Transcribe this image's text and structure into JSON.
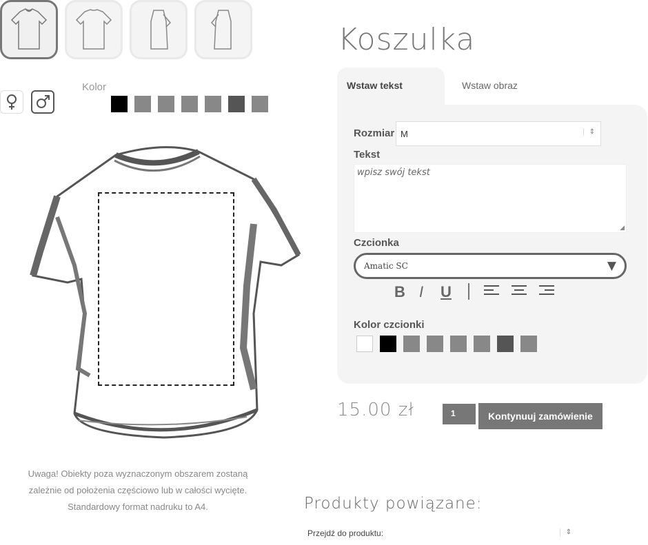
{
  "product": {
    "title": "Koszulka",
    "thumbnails": [
      {
        "view": "front",
        "active": true
      },
      {
        "view": "back",
        "active": false
      },
      {
        "view": "left-side",
        "active": false
      },
      {
        "view": "right-side",
        "active": false
      }
    ],
    "gender_icons": [
      {
        "icon": "female-icon",
        "active": false
      },
      {
        "icon": "male-icon",
        "active": true
      }
    ],
    "color_label": "Kolor",
    "shirt_colors": [
      "#ffffff",
      "#000000",
      "#888888",
      "#888888",
      "#888888",
      "#888888",
      "#555555",
      "#888888"
    ],
    "notice_lines": [
      "Uwaga! Obiekty poza wyznaczonym obszarem zostaną",
      "zależnie od położenia częściowo lub w całości wycięte.",
      "Standardowy format nadruku to A4."
    ]
  },
  "tabs": [
    {
      "label": "Wstaw tekst",
      "active": true
    },
    {
      "label": "Wstaw obraz",
      "active": false
    }
  ],
  "form": {
    "size_label": "Rozmiar",
    "size_value": "M",
    "text_label": "Tekst",
    "text_placeholder": "wpisz swój tekst",
    "font_label": "Czcionka",
    "font_value": "Amatic SC",
    "format_buttons": {
      "bold": "B",
      "italic": "I",
      "underline": "U"
    },
    "font_color_label": "Kolor czcionki",
    "font_colors": [
      "#ffffff",
      "#000000",
      "#888888",
      "#888888",
      "#888888",
      "#888888",
      "#555555",
      "#888888"
    ]
  },
  "order": {
    "price": "15.00 zł",
    "quantity": "1",
    "continue_label": "Kontynuuj zamówienie"
  },
  "related": {
    "heading": "Produkty powiązane:",
    "select_value": "Przejdź do produktu:"
  },
  "colors": {
    "accent": "#777777",
    "panel_bg": "#f4f4f4"
  }
}
